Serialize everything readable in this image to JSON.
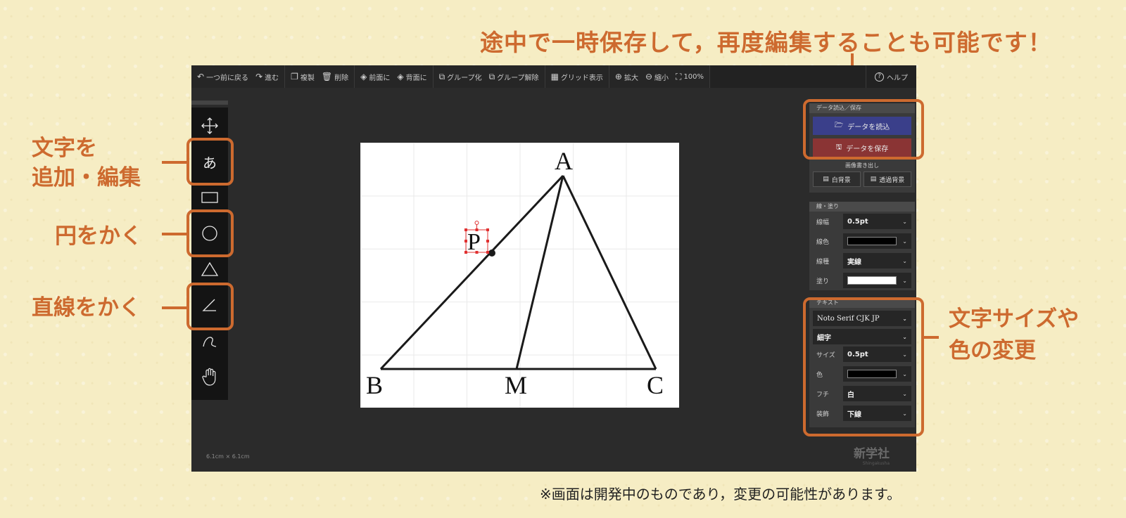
{
  "headline": "途中で一時保存して，再度編集することも可能です！",
  "callouts": {
    "text_line1": "文字を",
    "text_line2": "追加・編集",
    "circle": "円をかく",
    "line": "直線をかく",
    "size_line1": "文字サイズや",
    "size_line2": "色の変更"
  },
  "footnote": "※画面は開発中のものであり，変更の可能性があります。",
  "toolbar": {
    "undo": "一つ前に戻る",
    "redo": "進む",
    "duplicate": "複製",
    "delete": "削除",
    "front": "前面に",
    "back": "背面に",
    "group": "グループ化",
    "ungroup": "グループ解除",
    "grid": "グリッド表示",
    "zoom_in": "拡大",
    "zoom_out": "縮小",
    "zoom_level": "100%",
    "help": "ヘルプ"
  },
  "tools": [
    "move-icon",
    "text-icon",
    "rectangle-icon",
    "circle-icon",
    "triangle-icon",
    "line-icon",
    "freehand-icon",
    "hand-icon"
  ],
  "tool_text_glyph": "あ",
  "canvas": {
    "size_label": "6.1cm × 6.1cm",
    "labels": {
      "A": "A",
      "B": "B",
      "C": "C",
      "M": "M",
      "P": "P"
    }
  },
  "data_panel": {
    "header": "データ読込／保存",
    "load": "データを読込",
    "save": "データを保存",
    "export_label": "画像書き出し",
    "white_bg": "白背景",
    "transparent_bg": "透過背景"
  },
  "stroke_panel": {
    "header": "線・塗り",
    "width_label": "線幅",
    "width_value": "0.5pt",
    "color_label": "線色",
    "color_value": "#000000",
    "type_label": "線種",
    "type_value": "実線",
    "fill_label": "塗り",
    "fill_value": "#ffffff"
  },
  "text_panel": {
    "header": "テキスト",
    "font": "Noto Serif CJK JP",
    "weight": "細字",
    "size_label": "サイズ",
    "size_value": "0.5pt",
    "color_label": "色",
    "color_value": "#000000",
    "outline_label": "フチ",
    "outline_value": "白",
    "decoration_label": "装飾",
    "decoration_value": "下線"
  },
  "logo": {
    "name": "新学社",
    "sub": "Shingakusha"
  },
  "colors": {
    "accent": "#cd6a2f",
    "background": "#f6edc4",
    "app": "#2b2b2b",
    "load_button": "#3a3f8a",
    "save_button": "#8a3434"
  }
}
